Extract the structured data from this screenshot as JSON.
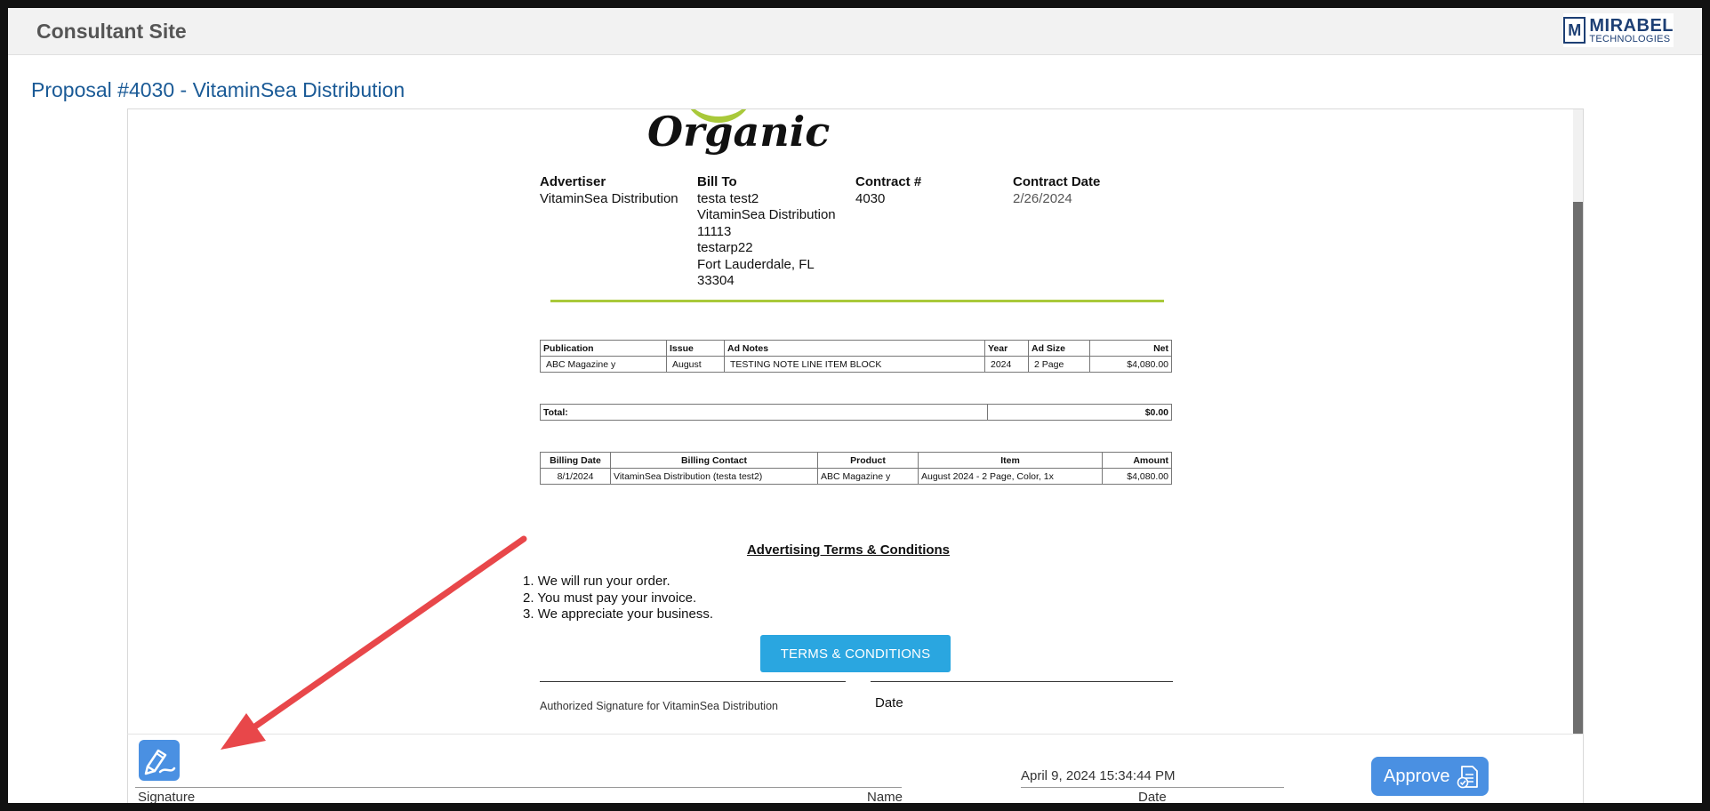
{
  "header": {
    "site_title": "Consultant Site",
    "logo": {
      "main": "MIRABEL",
      "sub": "TECHNOLOGIES",
      "mark": "M"
    }
  },
  "proposal_title": "Proposal #4030 - VitaminSea Distribution",
  "document": {
    "logo_text": "Organic",
    "advertiser": {
      "label": "Advertiser",
      "value": "VitaminSea Distribution"
    },
    "bill_to": {
      "label": "Bill To",
      "lines": [
        "testa test2",
        "VitaminSea Distribution",
        "11113",
        "testarp22",
        "Fort Lauderdale, FL",
        "33304"
      ]
    },
    "contract_no": {
      "label": "Contract #",
      "value": "4030"
    },
    "contract_date": {
      "label": "Contract Date",
      "value": "2/26/2024"
    },
    "line_items": {
      "headers": [
        "Publication",
        "Issue",
        "Ad Notes",
        "Year",
        "Ad Size",
        "Net"
      ],
      "rows": [
        [
          "ABC Magazine y",
          "August",
          "TESTING NOTE LINE ITEM BLOCK",
          "2024",
          "2 Page",
          "$4,080.00"
        ]
      ]
    },
    "total": {
      "label": "Total:",
      "value": "$0.00"
    },
    "billing": {
      "headers": [
        "Billing Date",
        "Billing Contact",
        "Product",
        "Item",
        "Amount"
      ],
      "rows": [
        [
          "8/1/2024",
          "VitaminSea Distribution (testa test2)",
          "ABC Magazine y",
          "August 2024 - 2 Page, Color, 1x",
          "$4,080.00"
        ]
      ]
    },
    "terms_heading": "Advertising Terms & Conditions",
    "terms": [
      "We will run your order.",
      "You must pay your invoice.",
      "We appreciate your business."
    ],
    "terms_button": "TERMS & CONDITIONS",
    "authorized_signature": "Authorized Signature for VitaminSea Distribution",
    "date_label": "Date"
  },
  "signature_panel": {
    "signature_label": "Signature",
    "name_label": "Name",
    "timestamp": "April 9, 2024 15:34:44 PM",
    "date_label": "Date",
    "approve_label": "Approve"
  },
  "colors": {
    "title_blue": "#1a5a96",
    "accent_green": "#a9c93a",
    "button_blue": "#2aa6e0",
    "approve_blue": "#4a90e2",
    "arrow_red": "#e8474a"
  }
}
